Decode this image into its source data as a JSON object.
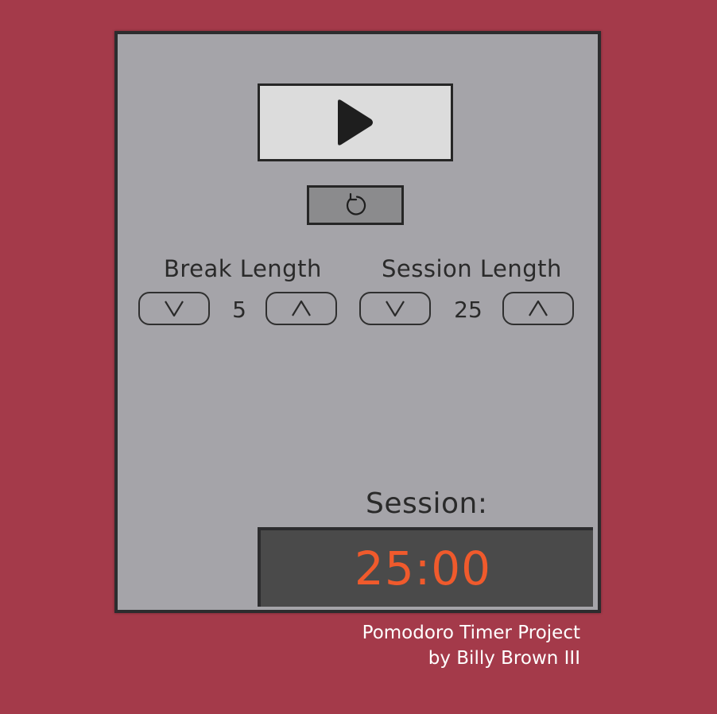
{
  "controls": {
    "play_icon": "play-icon",
    "reset_icon": "reset-icon"
  },
  "break": {
    "label": "Break Length",
    "value": "5",
    "decrement_icon": "chevron-down-icon",
    "increment_icon": "chevron-up-icon"
  },
  "session": {
    "label": "Session Length",
    "value": "25",
    "decrement_icon": "chevron-down-icon",
    "increment_icon": "chevron-up-icon"
  },
  "timer": {
    "label": "Session:",
    "time": "25:00"
  },
  "footer": {
    "line1": "Pomodoro Timer Project",
    "line2": "by Billy Brown III"
  },
  "colors": {
    "background": "#a43a4a",
    "panel": "#a5a4a9",
    "display": "#4a4a4a",
    "time": "#f05a2c"
  }
}
